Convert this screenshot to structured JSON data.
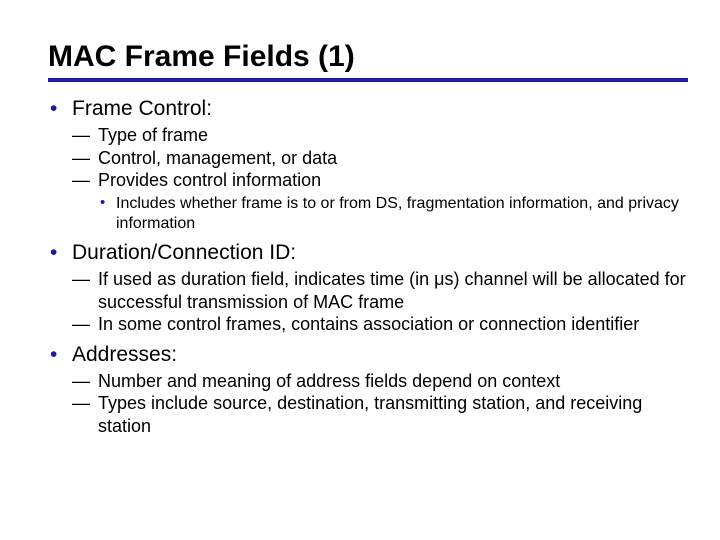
{
  "title": "MAC Frame Fields (1)",
  "bullets": {
    "b0": {
      "label": "Frame Control:",
      "sub": {
        "s0": "Type of frame",
        "s1": "Control, management, or data",
        "s2": "Provides control information",
        "s2_sub": {
          "t0": "Includes whether frame is to or from DS, fragmentation information, and privacy information"
        }
      }
    },
    "b1": {
      "label": "Duration/Connection ID:",
      "sub": {
        "s0": "If used as duration field, indicates time (in μs) channel will be allocated for successful transmission of MAC frame",
        "s1": "In some control frames, contains association or connection identifier"
      }
    },
    "b2": {
      "label": "Addresses:",
      "sub": {
        "s0": "Number and meaning of address fields depend on context",
        "s1": "Types include source, destination, transmitting station, and receiving station"
      }
    }
  }
}
